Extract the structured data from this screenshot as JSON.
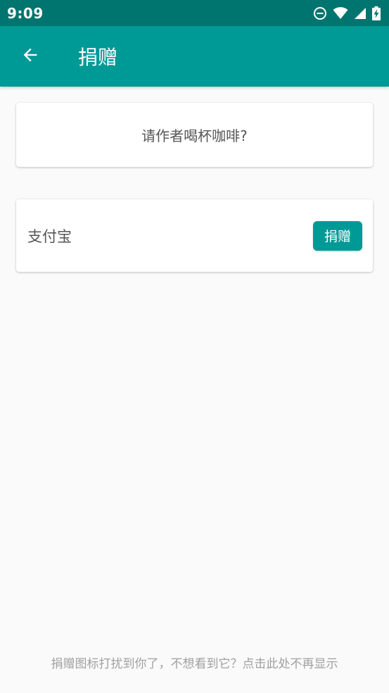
{
  "status_bar": {
    "time": "9:09",
    "icons": [
      "do-not-disturb-icon",
      "wifi-icon",
      "signal-icon",
      "battery-charging-icon"
    ]
  },
  "app_bar": {
    "back_icon": "arrow-left-icon",
    "title": "捐赠"
  },
  "header_card": {
    "text": "请作者喝杯咖啡?"
  },
  "donation_items": [
    {
      "name": "支付宝",
      "button_label": "捐赠"
    }
  ],
  "footer": {
    "hint": "捐赠图标打扰到你了，不想看到它？点击此处不再显示"
  },
  "colors": {
    "status_bar": "#00756f",
    "primary": "#009a96",
    "background": "#fafafa",
    "text_secondary": "#555555",
    "text_hint": "#a0a0a0"
  }
}
